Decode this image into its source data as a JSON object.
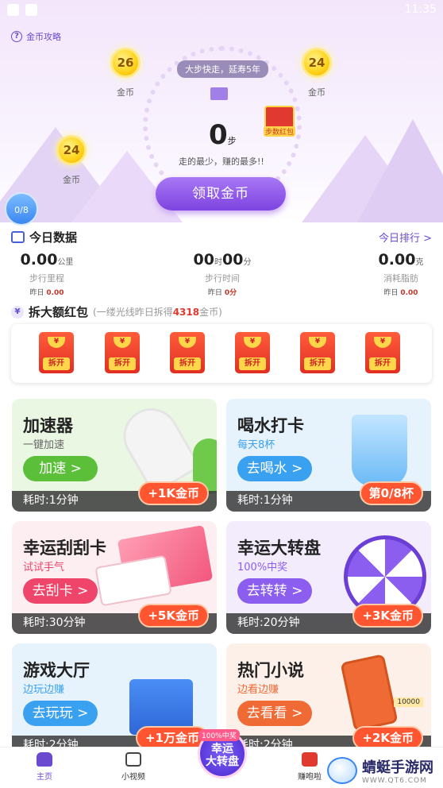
{
  "status_bar": {
    "time": "11:35"
  },
  "hero": {
    "gold_tips": "金币攻略",
    "coins": [
      {
        "value": "26",
        "label": "金币"
      },
      {
        "value": "24",
        "label": "金币"
      },
      {
        "value": "24",
        "label": "金币"
      }
    ],
    "slogan": "大步快走，延寿5年",
    "steps_value": "0",
    "steps_unit": "步",
    "steps_sub": "走的最少，赚的最多!!",
    "redpack_tag": "步数红包",
    "claim_button": "领取金币",
    "cup_progress": "0/8"
  },
  "today": {
    "title": "今日数据",
    "rank_link": "今日排行 >",
    "stats": [
      {
        "value": "0.00",
        "unit": "公里",
        "label": "步行里程",
        "yesterday_label": "昨日",
        "yesterday_value": "0.00"
      },
      {
        "hours": "00",
        "hours_unit": "时",
        "minutes": "00",
        "minutes_unit": "分",
        "label": "步行时间",
        "yesterday_label": "昨日",
        "yesterday_value": "0分"
      },
      {
        "value": "0.00",
        "unit": "克",
        "label": "消耗脂肪",
        "yesterday_label": "昨日",
        "yesterday_value": "0.00"
      }
    ]
  },
  "redpacket": {
    "title": "拆大额红包",
    "sub_prefix": "(一缕光线昨日拆得",
    "sub_amount": "4318",
    "sub_suffix": "金币)",
    "coin_symbol": "¥",
    "open_label": "拆开",
    "count": 6
  },
  "cards": [
    {
      "title": "加速器",
      "sub": "一键加速",
      "button": "加速 >",
      "time": "耗时:1分钟",
      "reward": "+1K金币",
      "btn_color": "#5bbf3a",
      "bg": "#eaf7e2"
    },
    {
      "title": "喝水打卡",
      "sub": "每天8杯",
      "button": "去喝水 >",
      "time": "耗时:1分钟",
      "reward": "第0/8杯",
      "btn_color": "#3aa0f0",
      "bg": "#e6f3fd"
    },
    {
      "title": "幸运刮刮卡",
      "sub": "试试手气",
      "button": "去刮卡 >",
      "time": "耗时:30分钟",
      "reward": "+5K金币",
      "btn_color": "#f0456a",
      "bg": "#fdeef1"
    },
    {
      "title": "幸运大转盘",
      "sub": "100%中奖",
      "button": "去转转 >",
      "time": "耗时:20分钟",
      "reward": "+3K金币",
      "btn_color": "#8c5ef0",
      "bg": "#f2ecfd"
    },
    {
      "title": "游戏大厅",
      "sub": "边玩边赚",
      "button": "去玩玩 >",
      "time": "耗时:2分钟",
      "reward": "+1万金币",
      "btn_color": "#3aa0f0",
      "bg": "#e6f3fd"
    },
    {
      "title": "热门小说",
      "sub": "边看边赚",
      "button": "去看看 >",
      "time": "耗时:2分钟",
      "reward": "+2K金币",
      "btn_color": "#f06a35",
      "bg": "#fdf0e8"
    }
  ],
  "tabs": [
    {
      "label": "主页",
      "active": true
    },
    {
      "label": "小视频",
      "active": false
    },
    {
      "label": "赚咆啦",
      "active": false
    }
  ],
  "wheel_badge": {
    "top": "100%中奖",
    "line1": "幸运",
    "line2": "大转盘"
  },
  "watermark": {
    "name": "蜻蜓手游网",
    "url": "WWW.QT6.COM"
  },
  "novel_counter": "10000"
}
